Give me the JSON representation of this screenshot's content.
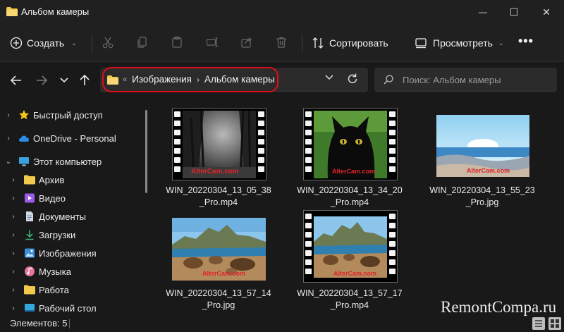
{
  "window": {
    "title": "Альбом камеры",
    "min_glyph": "—",
    "max_glyph": "☐",
    "close_glyph": "✕"
  },
  "toolbar": {
    "create_label": "Создать",
    "sort_label": "Сортировать",
    "view_label": "Просмотреть",
    "more_glyph": "•••",
    "action_icons": [
      "cut-icon",
      "copy-icon",
      "paste-icon",
      "rename-icon",
      "share-icon",
      "delete-icon"
    ]
  },
  "address": {
    "overflow_glyph": "«",
    "crumbs": [
      "Изображения",
      "Альбом камеры"
    ],
    "separator": "›"
  },
  "search": {
    "placeholder": "Поиск: Альбом камеры"
  },
  "sidebar": {
    "items": [
      {
        "label": "Быстрый доступ",
        "icon": "star-icon",
        "color": "#f5c518"
      },
      {
        "label": "OneDrive - Personal",
        "icon": "cloud-icon",
        "color": "#2b8be6"
      },
      {
        "label": "Этот компьютер",
        "icon": "computer-icon",
        "color": "#3aa0e0"
      },
      {
        "label": "Архив",
        "icon": "folder-icon",
        "color": "#f2c94c"
      },
      {
        "label": "Видео",
        "icon": "video-icon",
        "color": "#9b5de5"
      },
      {
        "label": "Документы",
        "icon": "documents-icon",
        "color": "#8fa6bd"
      },
      {
        "label": "Загрузки",
        "icon": "download-icon",
        "color": "#3bb273"
      },
      {
        "label": "Изображения",
        "icon": "pictures-icon",
        "color": "#3a8fd8"
      },
      {
        "label": "Музыка",
        "icon": "music-icon",
        "color": "#e8739c"
      },
      {
        "label": "Работа",
        "icon": "folder-icon",
        "color": "#f2c94c"
      },
      {
        "label": "Рабочий стол",
        "icon": "desktop-icon",
        "color": "#35a7df"
      }
    ]
  },
  "files": [
    {
      "name": "WIN_20220304_13_05_38_Pro.mp4",
      "line1": "WIN_20220304_13_05_38",
      "line2": "_Pro.mp4",
      "type": "video",
      "scene": "forest",
      "watermark": "AlterCam.com"
    },
    {
      "name": "WIN_20220304_13_34_20_Pro.mp4",
      "line1": "WIN_20220304_13_34_20",
      "line2": "_Pro.mp4",
      "type": "video",
      "scene": "cat",
      "watermark": "AlterCam.com"
    },
    {
      "name": "WIN_20220304_13_55_23_Pro.jpg",
      "line1": "WIN_20220304_13_55_23",
      "line2": "_Pro.jpg",
      "type": "image",
      "scene": "sea",
      "watermark": "AlterCam.com"
    },
    {
      "name": "WIN_20220304_13_57_14_Pro.jpg",
      "line1": "WIN_20220304_13_57_14",
      "line2": "_Pro.jpg",
      "type": "image",
      "scene": "beach",
      "watermark": "AlterCam.com"
    },
    {
      "name": "WIN_20220304_13_57_17_Pro.mp4",
      "line1": "WIN_20220304_13_57_17",
      "line2": "_Pro.mp4",
      "type": "video",
      "scene": "beach",
      "watermark": "AlterCam.com"
    }
  ],
  "status": {
    "items_label": "Элементов: 5"
  },
  "site_watermark": "RemontCompa.ru",
  "colors": {
    "accent_highlight": "#e00e18",
    "folder": "#f2c94c",
    "background": "#191919",
    "bar": "#202020"
  }
}
